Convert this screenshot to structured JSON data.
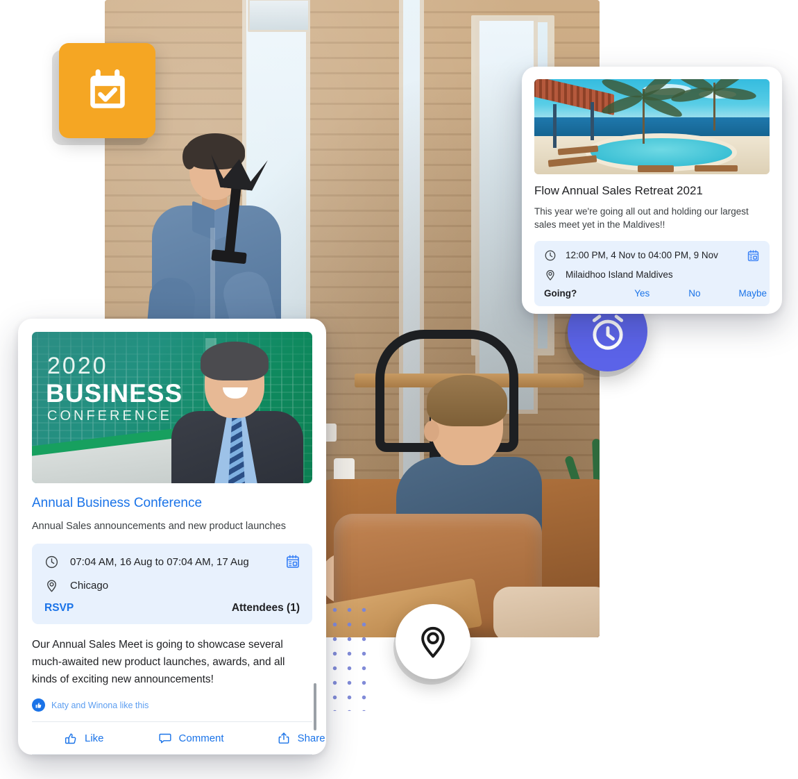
{
  "floating_badges": {
    "calendar_tile": {
      "icon": "calendar-check-icon",
      "color": "#f5a623"
    },
    "alarm_badge": {
      "icon": "alarm-clock-icon",
      "color": "#5b63e8"
    },
    "pin_badge": {
      "icon": "map-pin-icon",
      "color": "#ffffff"
    }
  },
  "background": {
    "scene": "office-interior-photo",
    "dot_grid": {
      "color": "#7b86d6",
      "name": "decorative-dot-grid"
    }
  },
  "retreat_card": {
    "media_alt": "maldives-pool-beach-photo",
    "title": "Flow Annual Sales Retreat 2021",
    "description": "This year we're going all out and holding our largest sales meet yet in the Maldives!!",
    "info": {
      "time_icon": "clock-icon",
      "time": "12:00 PM, 4 Nov to 04:00 PM, 9 Nov",
      "location_icon": "location-pin-icon",
      "location": "Milaidhoo Island Maldives",
      "calendar_icon": "add-to-calendar-icon"
    },
    "rsvp": {
      "question": "Going?",
      "options": [
        "Yes",
        "No",
        "Maybe"
      ]
    }
  },
  "conference_card": {
    "banner": {
      "year": "2020",
      "headline": "BUSINESS",
      "subline": "CONFERENCE",
      "alt": "business-conference-speaker-banner"
    },
    "title": "Annual Business Conference",
    "subtitle": "Annual Sales announcements and new product launches",
    "info": {
      "time_icon": "clock-icon",
      "time": "07:04 AM, 16 Aug to 07:04 AM, 17 Aug",
      "location_icon": "location-pin-icon",
      "location": "Chicago",
      "calendar_icon": "add-to-calendar-icon",
      "rsvp_label": "RSVP",
      "attendees_label": "Attendees (1)"
    },
    "body": "Our Annual Sales Meet is going to showcase several much-awaited new product launches, awards, and all kinds of exciting new announcements!",
    "likes_text": "Katy and Winona like this",
    "actions": [
      {
        "label": "Like",
        "icon": "thumbs-up-icon"
      },
      {
        "label": "Comment",
        "icon": "comment-bubble-icon"
      },
      {
        "label": "Share",
        "icon": "share-icon"
      }
    ]
  },
  "colors": {
    "accent_blue": "#1a73e8",
    "info_panel": "#e8f1fd",
    "orange": "#f5a623",
    "purple": "#5b63e8",
    "dot_purple": "#7b86d6"
  }
}
